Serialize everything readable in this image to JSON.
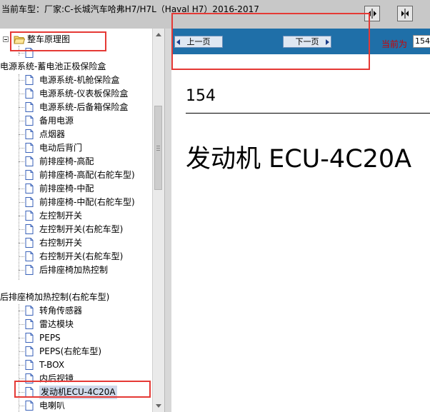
{
  "header": {
    "title": "当前车型：厂家:C-长城汽车哈弗H7/H7L（Haval H7）2016-2017"
  },
  "tree": {
    "root_label": "整车原理图",
    "group1_label": "电源系统-蓄电池正极保险盒",
    "group1_items": [
      "电源系统-机舱保险盒",
      "电源系统-仪表板保险盒",
      "电源系统-后备箱保险盒",
      "备用电源",
      "点烟器",
      "电动后背门",
      "前排座椅-高配",
      "前排座椅-高配(右舵车型)",
      "前排座椅-中配",
      "前排座椅-中配(右舵车型)",
      "左控制开关",
      "左控制开关(右舵车型)",
      "右控制开关",
      "右控制开关(右舵车型)",
      "后排座椅加热控制"
    ],
    "group2_label": "后排座椅加热控制(右舵车型)",
    "group2_items": [
      "转角传感器",
      "雷达模块",
      "PEPS",
      "PEPS(右舵车型)",
      "T-BOX",
      "内后视镜",
      "发动机ECU-4C20A",
      "电喇叭"
    ]
  },
  "nav": {
    "prev_label": "上一页",
    "next_label": "下一页",
    "current_label": "当前为",
    "page_value": "154"
  },
  "page": {
    "number": "154",
    "title": "发动机 ECU-4C20A"
  },
  "colors": {
    "nav_bar": "#1f6fa8",
    "annotation": "#e53935",
    "selected": "#cfd9ea"
  }
}
